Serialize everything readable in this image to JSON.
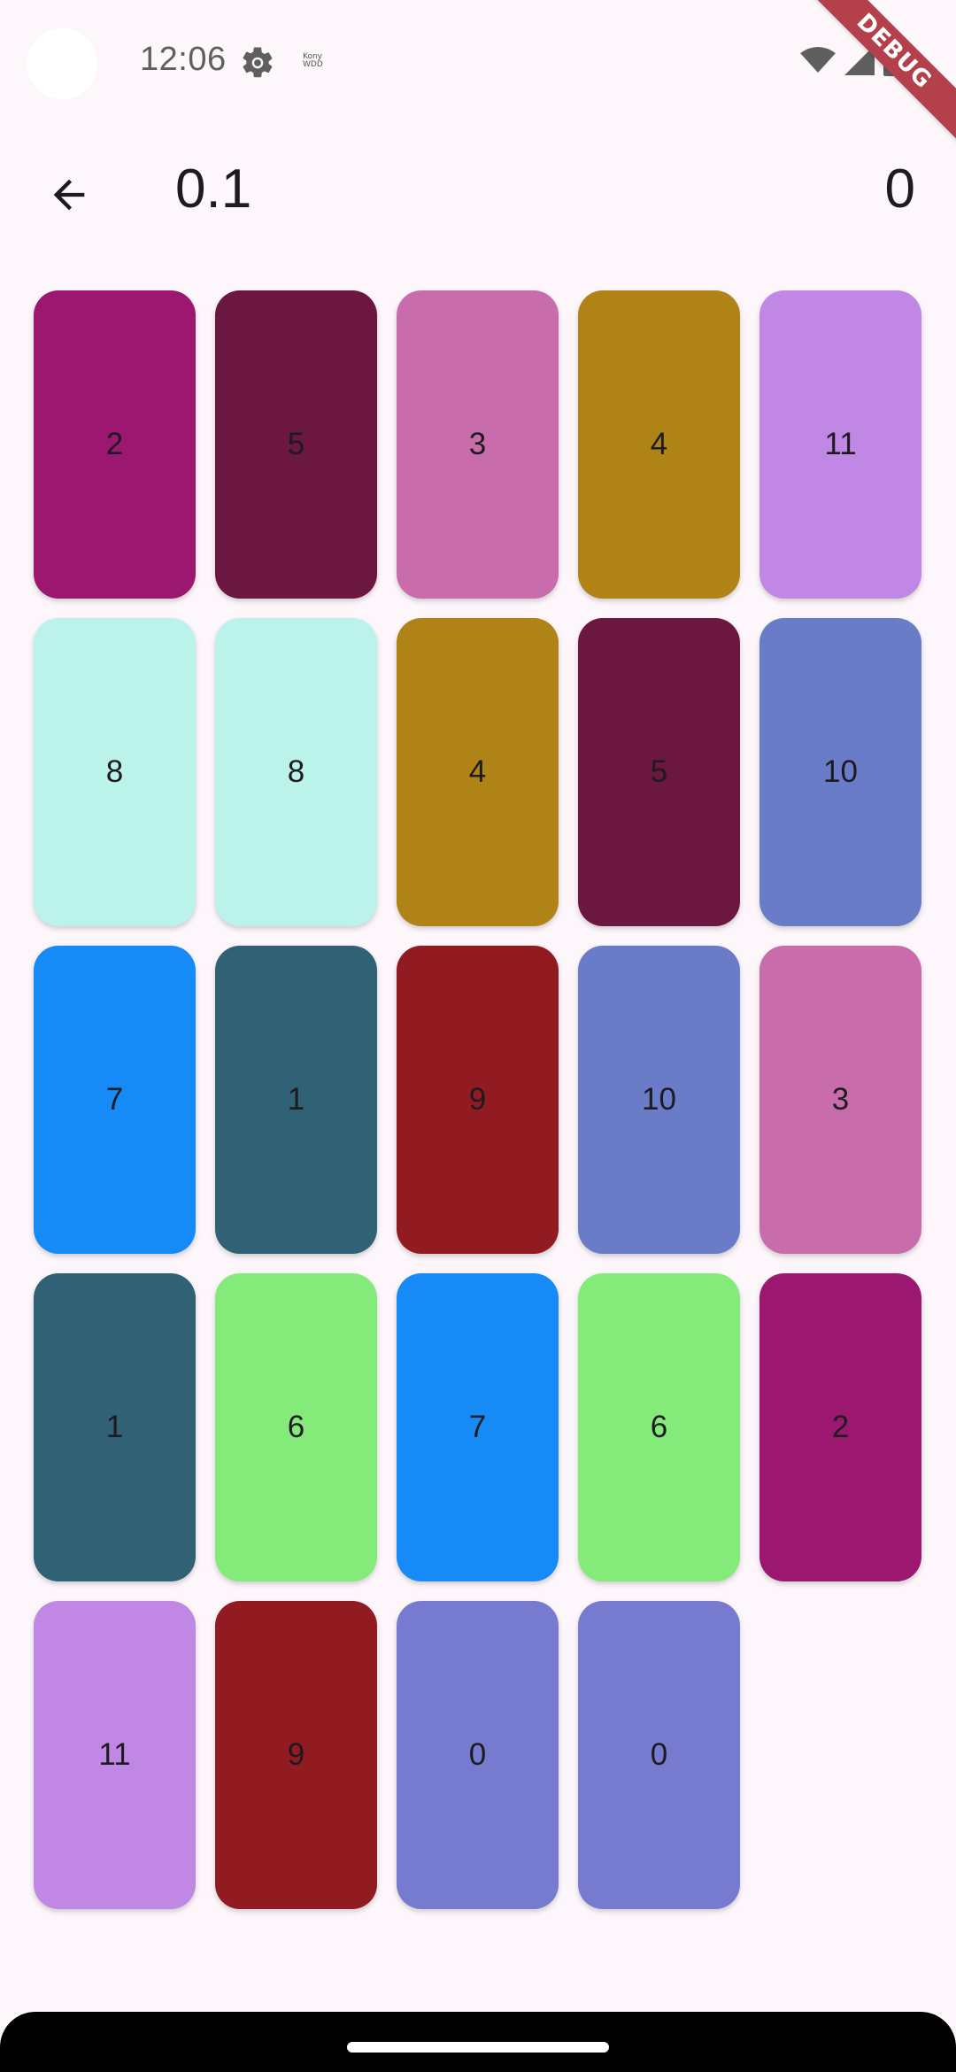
{
  "status_bar": {
    "time": "12:06",
    "notification_text": "Kony\nWDD"
  },
  "debug_banner": "DEBUG",
  "app_bar": {
    "title": "0.1",
    "score": "0"
  },
  "cards": [
    {
      "label": "2",
      "color": "#9c1870"
    },
    {
      "label": "5",
      "color": "#6b1740"
    },
    {
      "label": "3",
      "color": "#c86cac"
    },
    {
      "label": "4",
      "color": "#b08316"
    },
    {
      "label": "11",
      "color": "#c087e4"
    },
    {
      "label": "8",
      "color": "#bbf3eb"
    },
    {
      "label": "8",
      "color": "#bbf3eb"
    },
    {
      "label": "4",
      "color": "#b08316"
    },
    {
      "label": "5",
      "color": "#6b1740"
    },
    {
      "label": "10",
      "color": "#6a7cc8"
    },
    {
      "label": "7",
      "color": "#168bf8"
    },
    {
      "label": "1",
      "color": "#306175"
    },
    {
      "label": "9",
      "color": "#921b22"
    },
    {
      "label": "10",
      "color": "#6a7cc8"
    },
    {
      "label": "3",
      "color": "#c86cac"
    },
    {
      "label": "1",
      "color": "#306175"
    },
    {
      "label": "6",
      "color": "#84ea7a"
    },
    {
      "label": "7",
      "color": "#168bf8"
    },
    {
      "label": "6",
      "color": "#84ea7a"
    },
    {
      "label": "2",
      "color": "#9c1870"
    },
    {
      "label": "11",
      "color": "#c087e4"
    },
    {
      "label": "9",
      "color": "#921b22"
    },
    {
      "label": "0",
      "color": "#767bcf"
    },
    {
      "label": "0",
      "color": "#767bcf"
    }
  ]
}
